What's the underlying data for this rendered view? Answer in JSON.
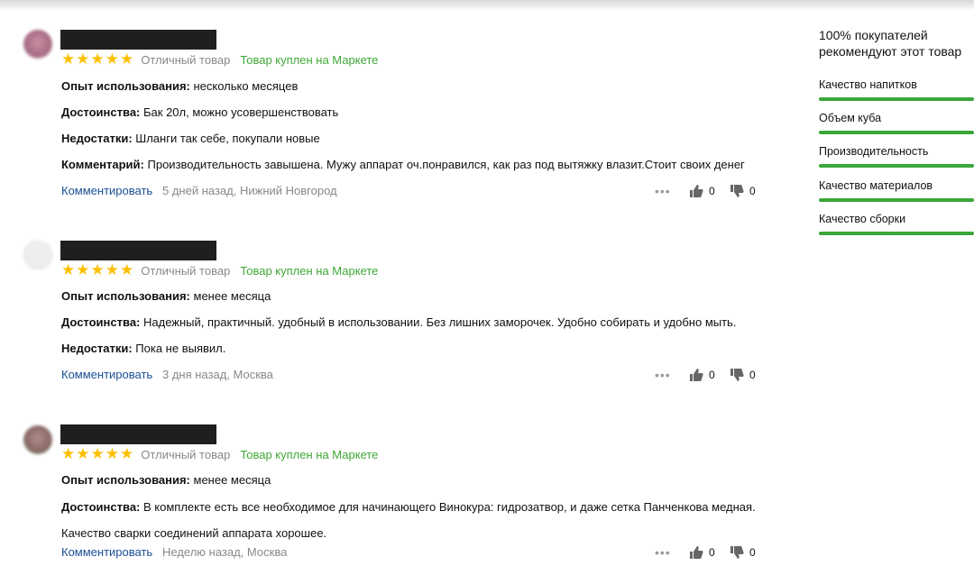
{
  "reviews": [
    {
      "verdict": "Отличный товар",
      "bought": "Товар куплен на Маркете",
      "rating": 5,
      "fields": [
        {
          "label": "Опыт использования:",
          "value": "несколько месяцев"
        },
        {
          "label": "Достоинства:",
          "value": "Бак 20л, можно усовершенствовать"
        },
        {
          "label": "Недостатки:",
          "value": "Шланги так себе, покупали новые"
        },
        {
          "label": "Комментарий:",
          "value": "Производительность завышена. Мужу аппарат оч.понравился, как раз под вытяжку влазит.Стоит своих денег"
        }
      ],
      "comment_link": "Комментировать",
      "meta": "5 дней назад, Нижний Новгород",
      "likes": "0",
      "dislikes": "0"
    },
    {
      "verdict": "Отличный товар",
      "bought": "Товар куплен на Маркете",
      "rating": 5,
      "fields": [
        {
          "label": "Опыт использования:",
          "value": "менее месяца"
        },
        {
          "label": "Достоинства:",
          "value": "Надежный, практичный. удобный в использовании. Без лишних заморочек. Удобно собирать и удобно мыть."
        },
        {
          "label": "Недостатки:",
          "value": "Пока не выявил."
        }
      ],
      "comment_link": "Комментировать",
      "meta": "3 дня назад, Москва",
      "likes": "0",
      "dislikes": "0"
    },
    {
      "verdict": "Отличный товар",
      "bought": "Товар куплен на Маркете",
      "rating": 5,
      "fields": [
        {
          "label": "Опыт использования:",
          "value": "менее месяца"
        },
        {
          "label": "Достоинства:",
          "value": "В комплекте есть все необходимое для начинающего Винокура: гидрозатвор, и даже сетка Панченкова медная.",
          "continuation": "Качество сварки соединений аппарата хорошее."
        }
      ],
      "comment_link": "Комментировать",
      "meta": "Неделю назад, Москва",
      "likes": "0",
      "dislikes": "0"
    }
  ],
  "summary": {
    "line1": "100% покупателей",
    "line2": "рекомендуют этот товар",
    "metrics": [
      {
        "label": "Качество напитков",
        "score": 1.0
      },
      {
        "label": "Объем куба",
        "score": 1.0
      },
      {
        "label": "Производительность",
        "score": 1.0
      },
      {
        "label": "Качество материалов",
        "score": 1.0
      },
      {
        "label": "Качество сборки",
        "score": 1.0
      }
    ]
  },
  "colors": {
    "star": "#fdbf02",
    "bought_green": "#3fa836",
    "link_blue": "#1a4f95",
    "bar_green": "#3ba53a",
    "muted": "#888888"
  },
  "icons": {
    "star": "star-icon",
    "like": "thumb-up-icon",
    "dislike": "thumb-down-icon",
    "more": "more-dots-icon"
  }
}
